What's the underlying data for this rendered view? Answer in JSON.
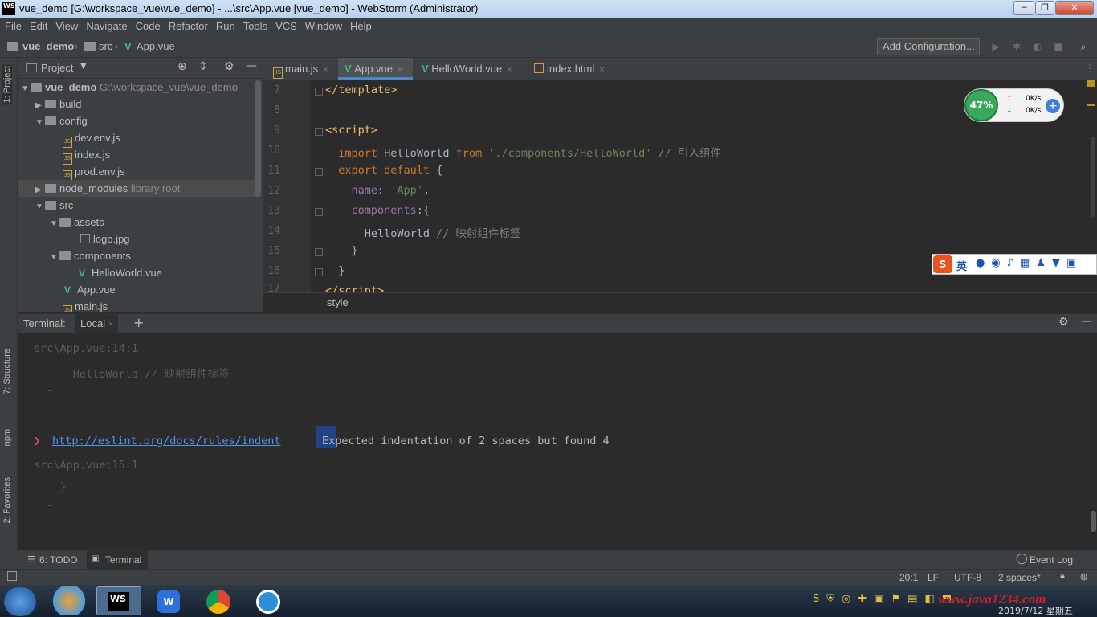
{
  "window": {
    "title": "vue_demo [G:\\workspace_vue\\vue_demo] - ...\\src\\App.vue [vue_demo] - WebStorm (Administrator)",
    "app_icon": "WS"
  },
  "menu": [
    "File",
    "Edit",
    "View",
    "Navigate",
    "Code",
    "Refactor",
    "Run",
    "Tools",
    "VCS",
    "Window",
    "Help"
  ],
  "breadcrumb": {
    "project": "vue_demo",
    "folder": "src",
    "file": "App.vue"
  },
  "toolbar": {
    "add_configuration": "Add Configuration..."
  },
  "left_strip": {
    "project_tab": "1: Project",
    "structure_tab": "7: Structure",
    "npm_tab": "npm",
    "favorites_tab": "2: Favorites"
  },
  "project_panel": {
    "title": "Project",
    "tree": [
      {
        "label": "vue_demo",
        "extra": "G:\\workspace_vue\\vue_demo"
      },
      {
        "label": "build"
      },
      {
        "label": "config"
      },
      {
        "label": "dev.env.js"
      },
      {
        "label": "index.js"
      },
      {
        "label": "prod.env.js"
      },
      {
        "label": "node_modules",
        "extra": "library root"
      },
      {
        "label": "src"
      },
      {
        "label": "assets"
      },
      {
        "label": "logo.jpg"
      },
      {
        "label": "components"
      },
      {
        "label": "HelloWorld.vue"
      },
      {
        "label": "App.vue"
      },
      {
        "label": "main.js"
      }
    ]
  },
  "editor_tabs": [
    {
      "label": "main.js"
    },
    {
      "label": "App.vue"
    },
    {
      "label": "HelloWorld.vue"
    },
    {
      "label": "index.html"
    }
  ],
  "editor": {
    "line_numbers": [
      "7",
      "8",
      "9",
      "10",
      "11",
      "12",
      "13",
      "14",
      "15",
      "16",
      "17"
    ],
    "breadcrumb": "style"
  },
  "terminal": {
    "label": "Terminal:",
    "tab": "Local",
    "lines": {
      "loc1": "src\\App.vue:14:1",
      "code1": "      HelloWorld // 映射组件标签",
      "dash1": "  -",
      "link": "http://eslint.org/docs/rules/indent",
      "message": "Expected indentation of 2 spaces but found 4",
      "loc2": "src\\App.vue:15:1",
      "code2": "    }",
      "dash2": "  -"
    }
  },
  "bottom_tabs": {
    "todo": "6: TODO",
    "terminal": "Terminal",
    "event_log": "Event Log"
  },
  "status": {
    "position": "20:1",
    "line_sep": "LF",
    "encoding": "UTF-8",
    "indent": "2 spaces*"
  },
  "net_widget": {
    "percent": "47%",
    "up": "0K/s",
    "down": "0K/s"
  },
  "ime": {
    "lang": "英"
  },
  "taskbar": {
    "watermark": "www.java1234.com",
    "date": "2019/7/12 星期五"
  }
}
